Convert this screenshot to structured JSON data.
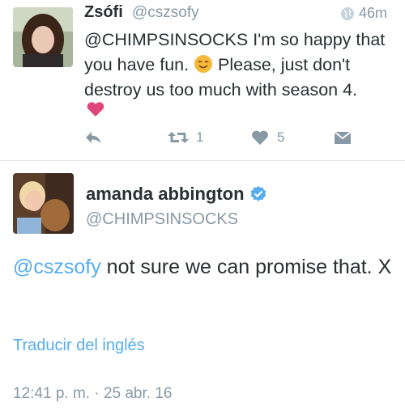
{
  "reply": {
    "name": "Zsófi",
    "handle": "@cszsofy",
    "time": "46m",
    "text_mention": "@CHIMPSINSOCKS",
    "text_part1": " I'm so happy that you have fun. ",
    "text_part2": " Please, just don't destroy us too much with season 4.",
    "retweet_count": "1",
    "like_count": "5"
  },
  "main": {
    "name": "amanda abbington",
    "handle": "@CHIMPSINSOCKS",
    "mention": "@cszsofy",
    "text": " not sure we can promise that. X",
    "translate_label": "Traducir del inglés",
    "timestamp": "12:41 p. m. · 25 abr. 16"
  },
  "colors": {
    "accent": "#55acee",
    "muted": "#8899a6",
    "heart": "#e0245e",
    "verified": "#55acee"
  },
  "icons": [
    "globe-icon",
    "smile-emoji-icon",
    "heart-emoji-icon",
    "reply-icon",
    "retweet-icon",
    "like-icon",
    "dm-icon",
    "verified-icon"
  ]
}
